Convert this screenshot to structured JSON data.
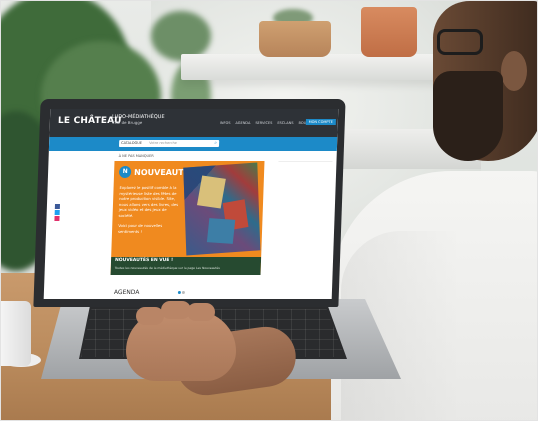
{
  "site": {
    "logo": "LE CHÂTEAU",
    "brand_title": "LUDO-MÉDIATHÈQUE",
    "brand_subtitle": "Ville de Brugge",
    "nav": [
      "INFOS",
      "AGENDA",
      "SERVICES",
      "ESCLANS",
      "BOUTIQUE"
    ],
    "cta": "MON COMPTE",
    "search": {
      "select_label": "CATALOGUE",
      "placeholder": "Votre recherche"
    },
    "breadcrumb": "À NE PAS MANQUER",
    "banner": {
      "badge": "N",
      "title": "NOUVEAUTÉS",
      "text": "Explorez le positif comble à la mystérieuse liste des fêtes de notre production visible. Site, nous allons vers des livres, des jeux vidéo et des jeux de société.",
      "text2": "Voici pour de nouvelles sentiments !",
      "news_title": "NOUVEAUTÉS EN VUE !",
      "news_text": "Toutes les nouveautés de la médiathèque sur la page Les Nouveautés"
    },
    "section": "AGENDA"
  },
  "colors": {
    "header": "#2e3237",
    "accent_blue": "#1c8ac8",
    "banner_orange": "#f08a1f",
    "news_green": "#264a30"
  }
}
